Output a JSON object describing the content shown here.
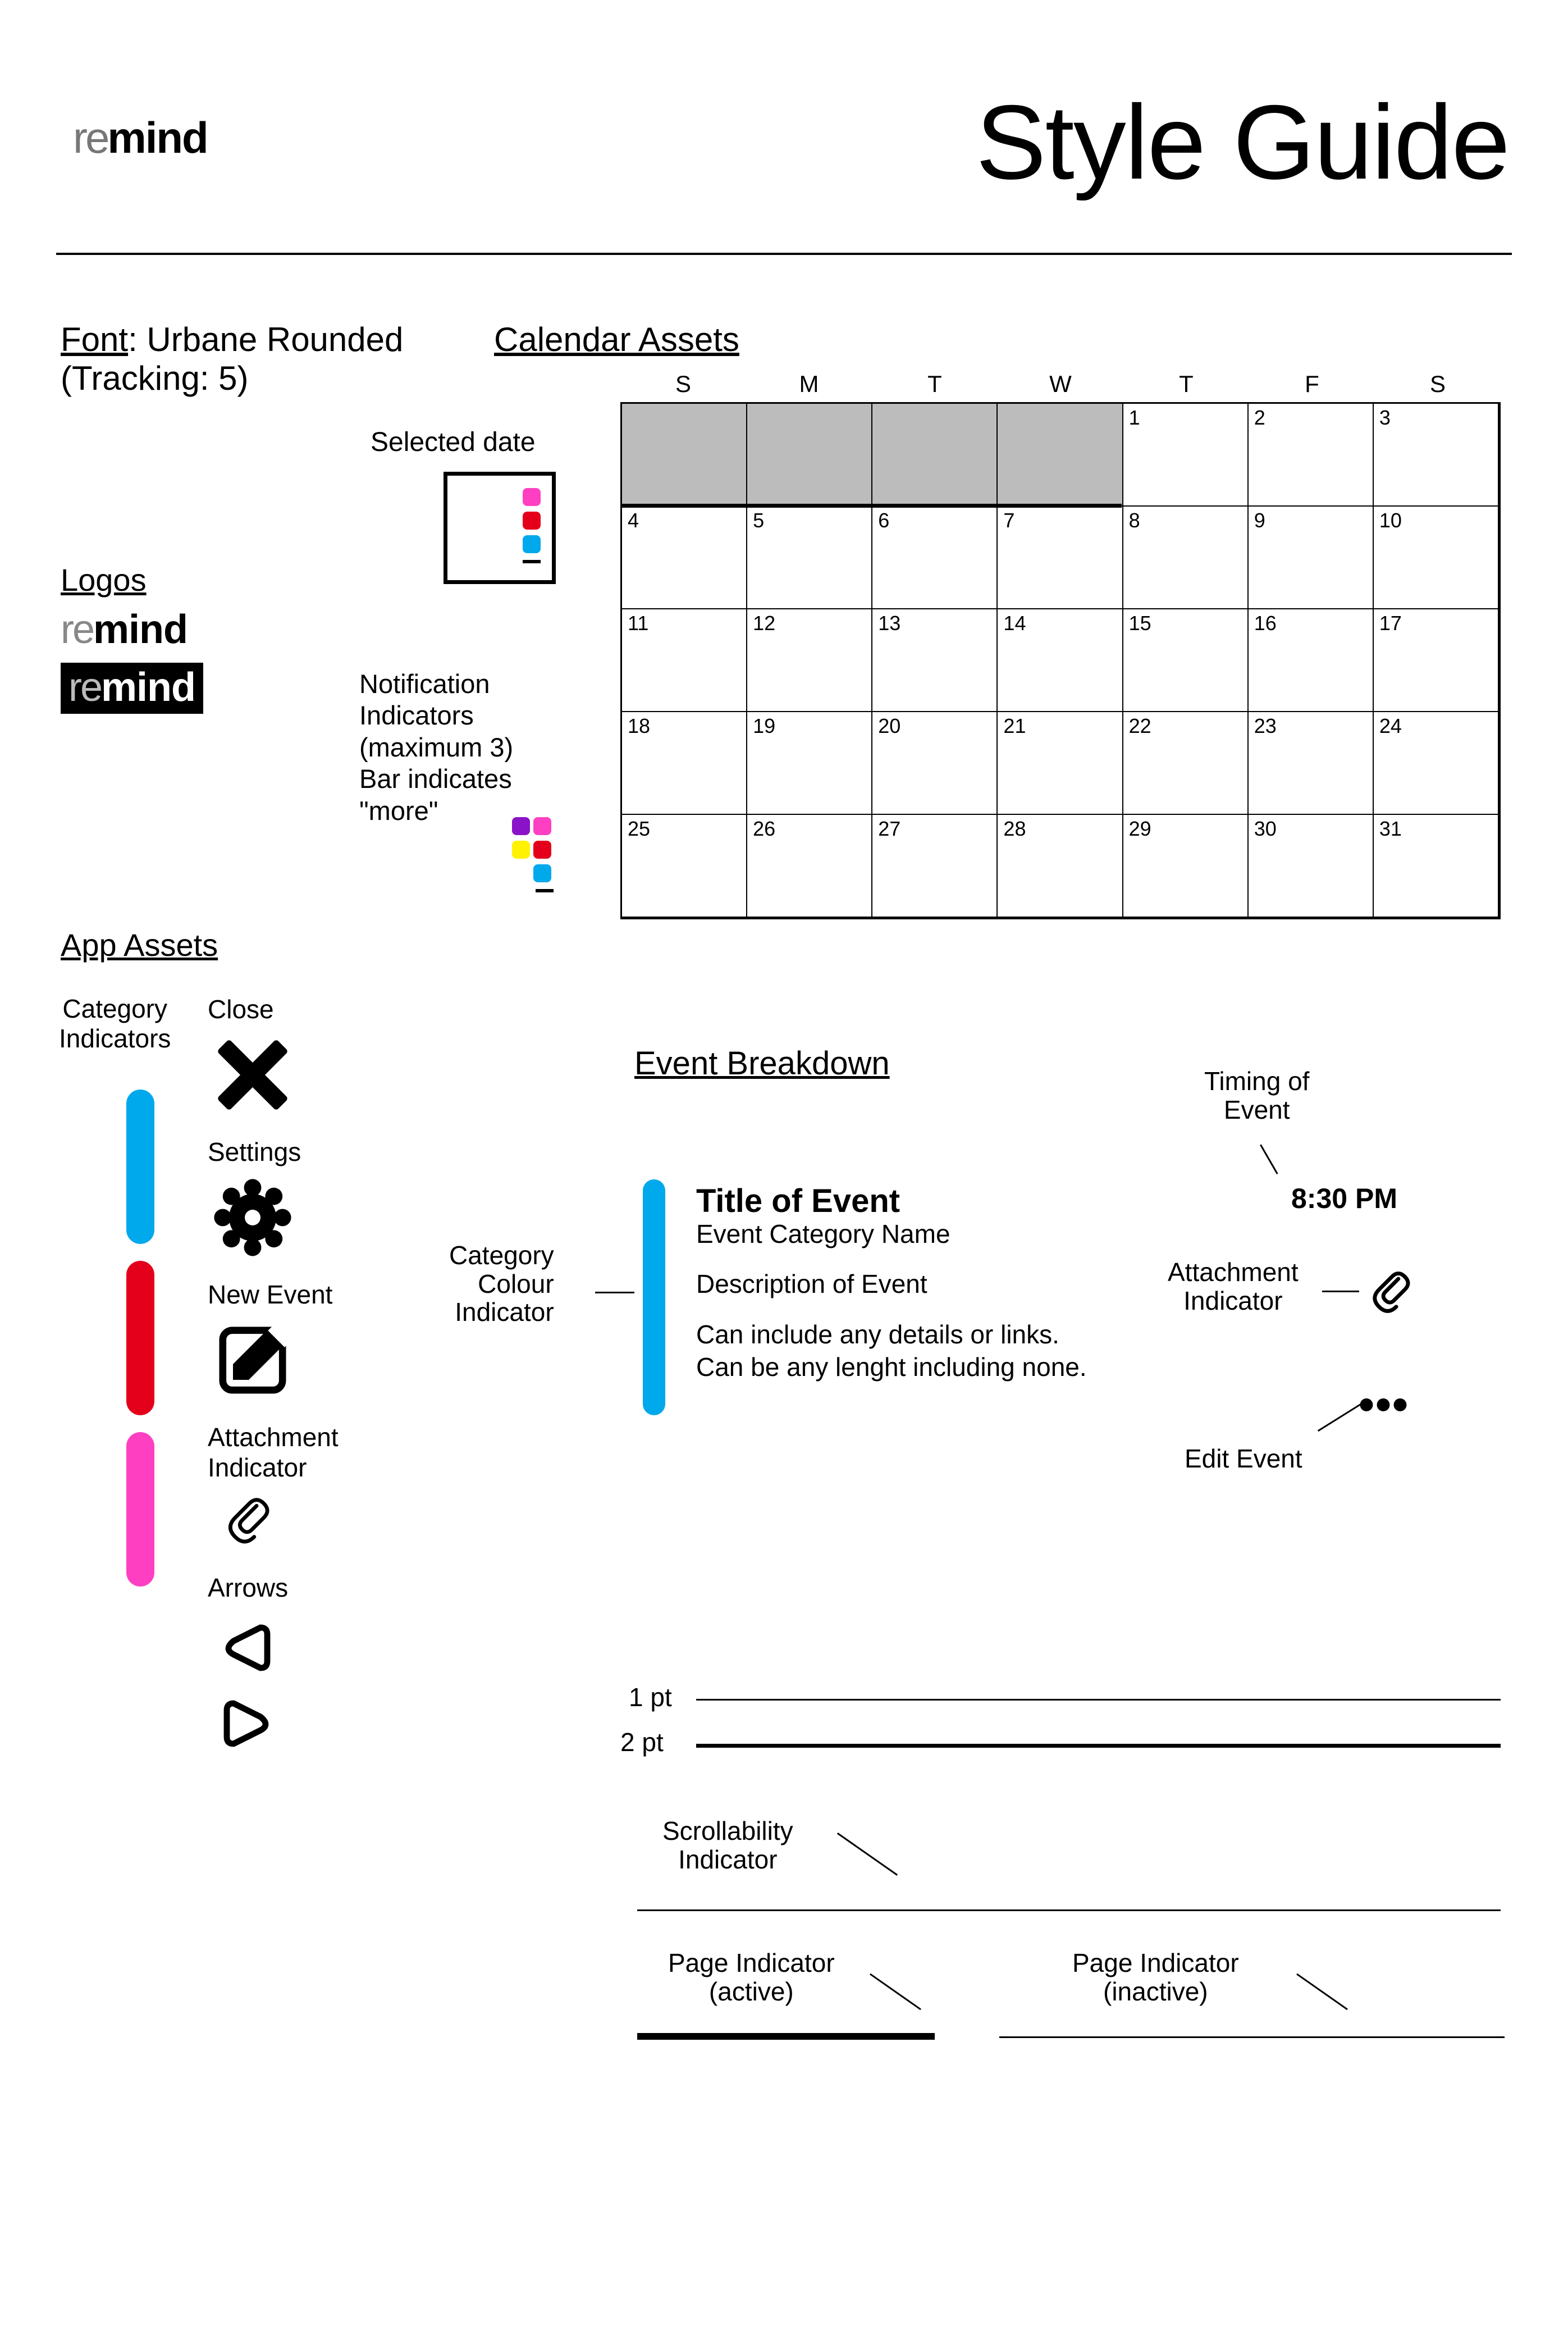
{
  "header": {
    "logo_re": "re",
    "logo_mind": "mind",
    "title": "Style Guide"
  },
  "font": {
    "label": "Font",
    "name": ": Urbane Rounded",
    "tracking": "(Tracking: 5)"
  },
  "calendar": {
    "heading": "Calendar Assets",
    "selected_label": "Selected date",
    "days": [
      "S",
      "M",
      "T",
      "W",
      "T",
      "F",
      "S"
    ],
    "rows": [
      {
        "cells": [
          "",
          "",
          "",
          "",
          "1",
          "2",
          "3"
        ],
        "grey_count": 4
      },
      {
        "cells": [
          "4",
          "5",
          "6",
          "7",
          "8",
          "9",
          "10"
        ]
      },
      {
        "cells": [
          "11",
          "12",
          "13",
          "14",
          "15",
          "16",
          "17"
        ]
      },
      {
        "cells": [
          "18",
          "19",
          "20",
          "21",
          "22",
          "23",
          "24"
        ]
      },
      {
        "cells": [
          "25",
          "26",
          "27",
          "28",
          "29",
          "30",
          "31"
        ]
      }
    ]
  },
  "logos": {
    "heading": "Logos"
  },
  "notif": {
    "line1": "Notification",
    "line2": "Indicators",
    "line3": "(maximum 3)",
    "line4": "Bar indicates",
    "line5": "\"more\""
  },
  "colors": {
    "blue": "#00a8ec",
    "red": "#e4001b",
    "pink": "#ff3fc1",
    "purple": "#8a12c9",
    "yellow": "#fff200"
  },
  "app": {
    "heading": "App Assets",
    "category_label_l1": "Category",
    "category_label_l2": "Indicators",
    "close": "Close",
    "settings": "Settings",
    "new_event": "New Event",
    "attachment": "Attachment",
    "attachment2": "Indicator",
    "arrows": "Arrows"
  },
  "event": {
    "heading": "Event Breakdown",
    "timing_label_l1": "Timing of",
    "timing_label_l2": "Event",
    "timing_value": "8:30 PM",
    "cat_color_l1": "Category",
    "cat_color_l2": "Colour",
    "cat_color_l3": "Indicator",
    "title": "Title of Event",
    "category": "Event Category Name",
    "description": "Description of Event",
    "details_l1": "Can include any details or links.",
    "details_l2": "Can be any lenght including none.",
    "attach_l1": "Attachment",
    "attach_l2": "Indicator",
    "edit": "Edit Event",
    "dots": "•••"
  },
  "lines": {
    "pt1": "1 pt",
    "pt2": "2 pt",
    "scroll_l1": "Scrollability",
    "scroll_l2": "Indicator",
    "pi_active_l1": "Page Indicator",
    "pi_active_l2": "(active)",
    "pi_inactive_l1": "Page Indicator",
    "pi_inactive_l2": "(inactive)"
  }
}
